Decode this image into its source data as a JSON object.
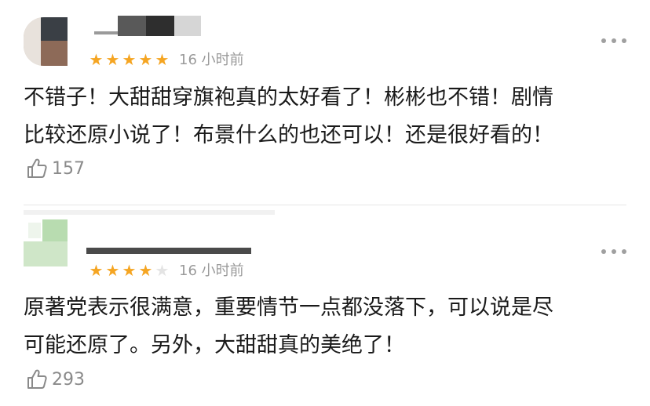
{
  "reviews": [
    {
      "rating": 5,
      "max_rating": 5,
      "time": "16 小时前",
      "content_line1": "不错子！大甜甜穿旗袍真的太好看了！彬彬也不错！剧情",
      "content_line2": "比较还原小说了！布景什么的也还可以！还是很好看的！",
      "likes": "157",
      "star_color": "#f5a522"
    },
    {
      "rating": 4,
      "max_rating": 5,
      "time": "16 小时前",
      "content_line1": "原著党表示很满意，重要情节一点都没落下，可以说是尽",
      "content_line2": "可能还原了。另外，大甜甜真的美绝了！",
      "likes": "293",
      "star_color": "#f5a522"
    }
  ],
  "icons": {
    "like": "thumbs-up-icon",
    "more": "more-dots-icon",
    "star": "star-icon"
  }
}
